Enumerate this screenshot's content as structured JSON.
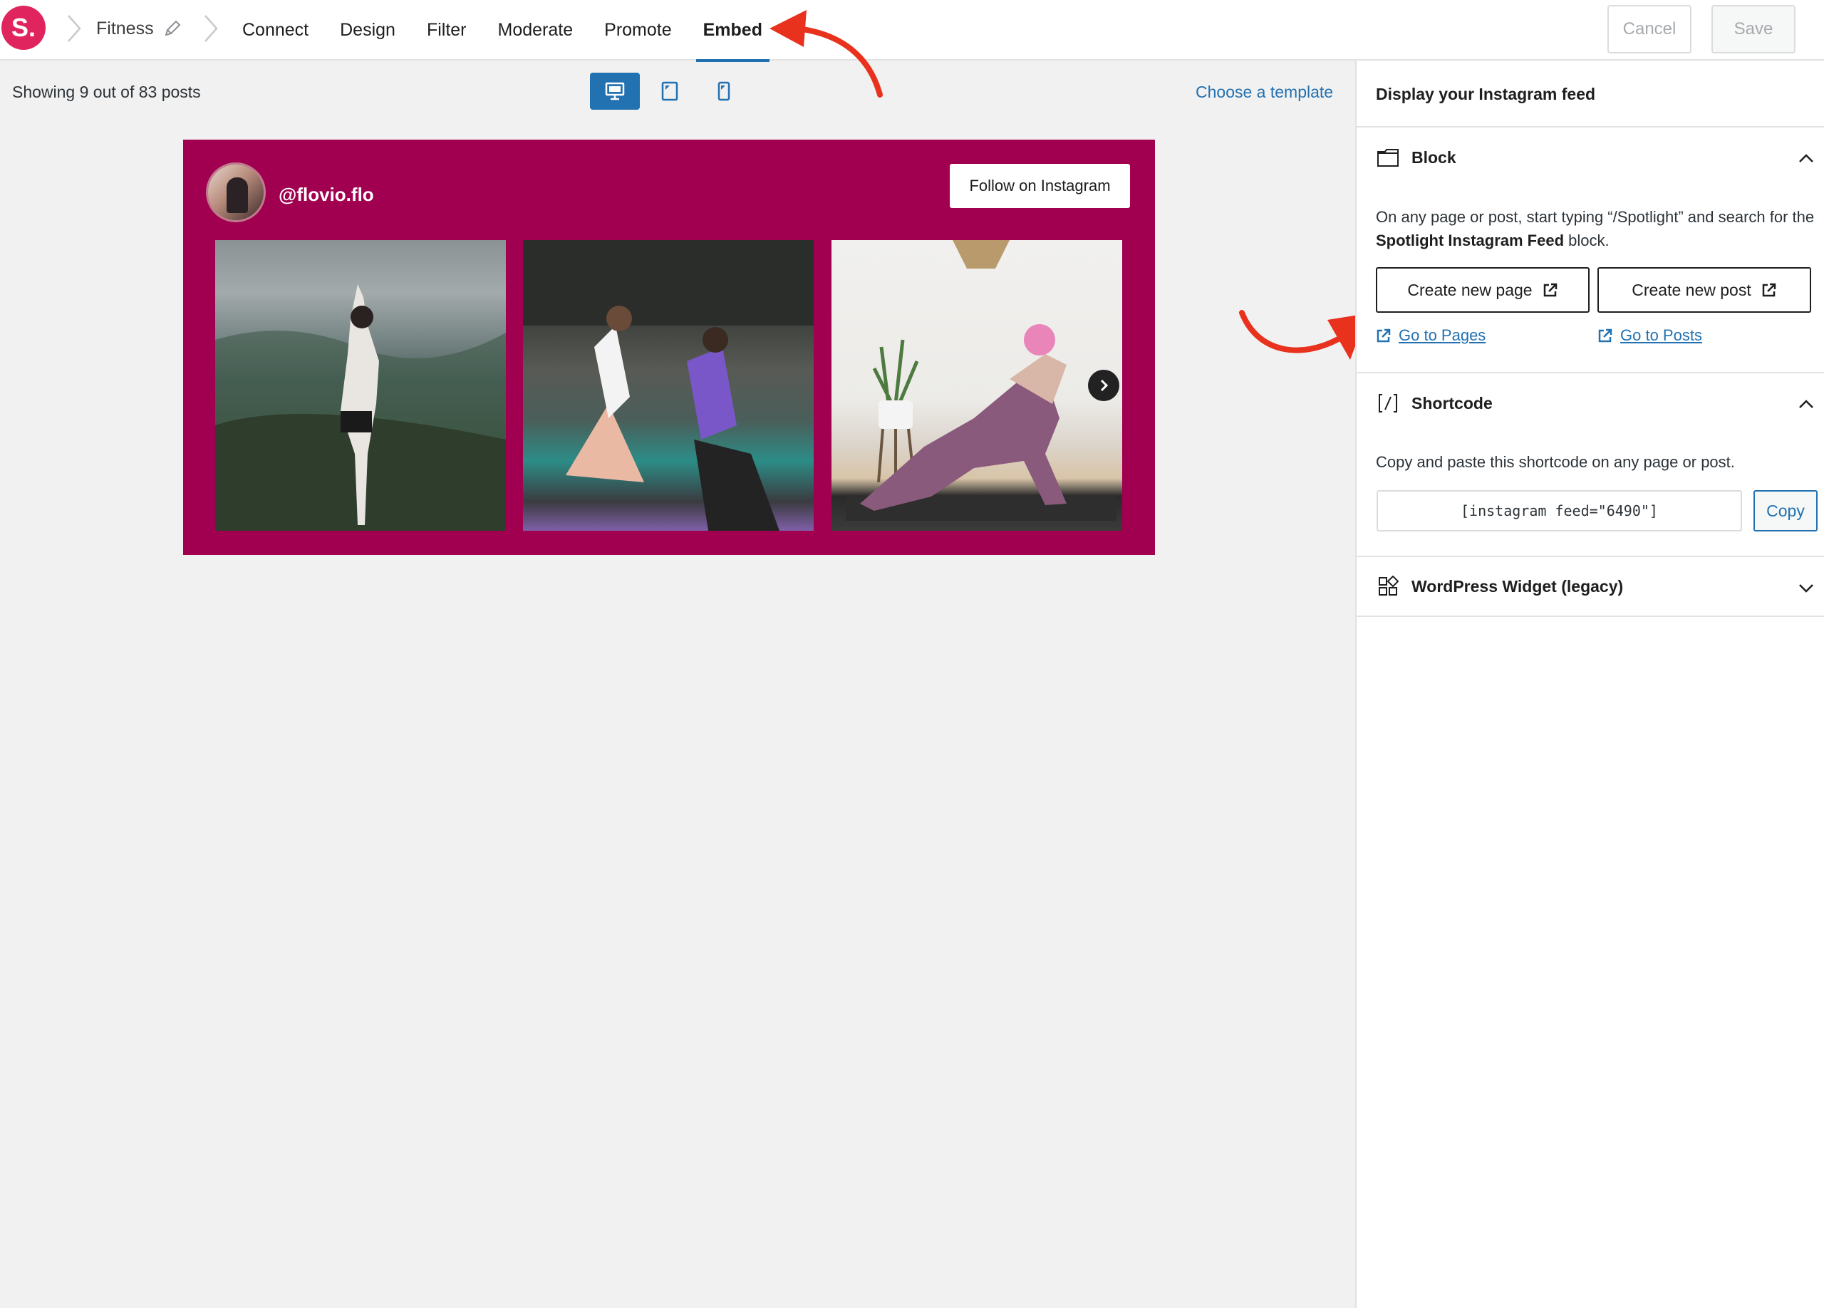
{
  "app": {
    "logo_text": "S.",
    "feed_name": "Fitness"
  },
  "tabs": [
    {
      "label": "Connect"
    },
    {
      "label": "Design"
    },
    {
      "label": "Filter"
    },
    {
      "label": "Moderate"
    },
    {
      "label": "Promote"
    },
    {
      "label": "Embed",
      "active": true
    }
  ],
  "toolbar": {
    "cancel_label": "Cancel",
    "save_label": "Save"
  },
  "preview": {
    "showing_text": "Showing 9 out of 83 posts",
    "choose_template_label": "Choose a template",
    "devices": [
      "desktop-icon",
      "tablet-icon",
      "phone-icon"
    ],
    "active_device": "desktop"
  },
  "feed": {
    "handle": "@flovio.flo",
    "follow_label": "Follow on Instagram",
    "background_color": "#a0004f"
  },
  "sidebar": {
    "title": "Display your Instagram feed",
    "block": {
      "label": "Block",
      "description_pre": "On any page or post, start typing “/Spotlight” and search for the ",
      "description_bold": "Spotlight Instagram Feed",
      "description_post": " block.",
      "create_page_label": "Create new page",
      "create_post_label": "Create new post",
      "go_pages_label": "Go to Pages",
      "go_posts_label": "Go to Posts"
    },
    "shortcode": {
      "label": "Shortcode",
      "description": "Copy and paste this shortcode on any page or post.",
      "value": "[instagram feed=\"6490\"]",
      "copy_label": "Copy"
    },
    "widget": {
      "label": "WordPress Widget (legacy)"
    }
  },
  "colors": {
    "accent": "#2271b1",
    "brand": "#e0245e",
    "annotation": "#e8321e"
  }
}
